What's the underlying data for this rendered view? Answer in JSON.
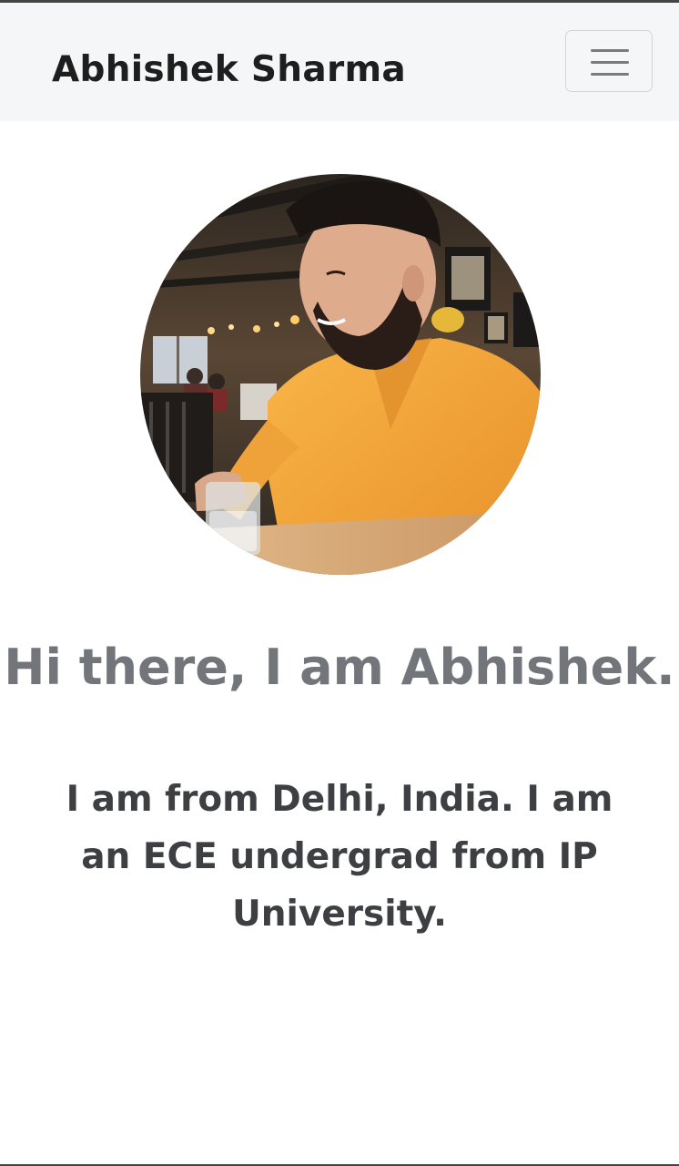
{
  "navbar": {
    "brand": "Abhishek Sharma",
    "menu_icon": "hamburger-menu-icon"
  },
  "profile": {
    "photo_description": "profile-photo"
  },
  "hero": {
    "greeting": "Hi there, I am Abhishek.",
    "bio": "I am from Delhi, India. I am an ECE undergrad from IP University."
  },
  "colors": {
    "navbar_bg": "#f5f6f8",
    "brand_text": "#1e1e1e",
    "greeting_text": "#727579",
    "bio_text": "#3d3f42",
    "shirt": "#f4a235"
  }
}
